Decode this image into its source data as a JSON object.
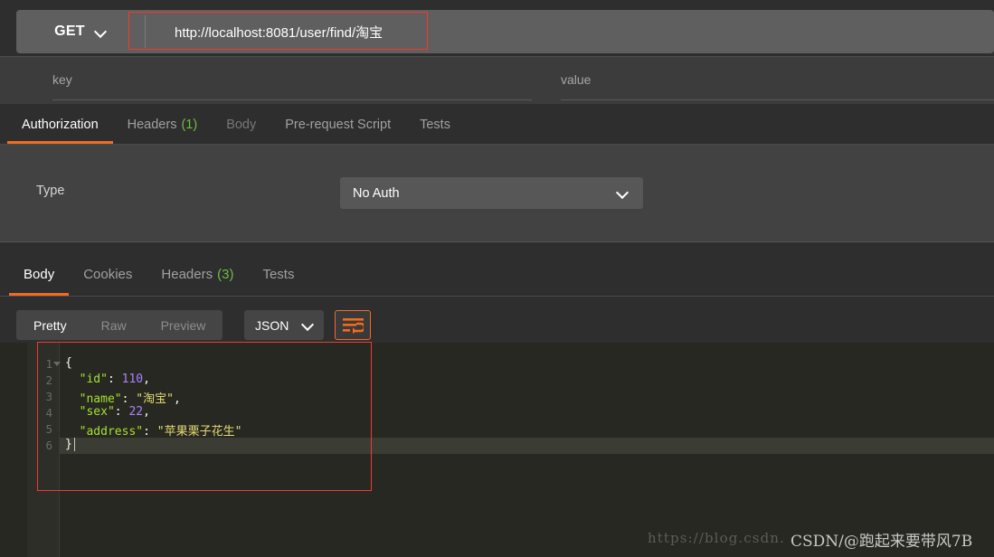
{
  "request": {
    "method": "GET",
    "method_chevron_icon": "chevron-down-icon",
    "url": "http://localhost:8081/user/find/淘宝",
    "params": {
      "key_placeholder": "key",
      "value_placeholder": "value"
    },
    "tabs": [
      {
        "label": "Authorization",
        "count": "",
        "state": "active"
      },
      {
        "label": "Headers",
        "count": "(1)",
        "state": "normal"
      },
      {
        "label": "Body",
        "count": "",
        "state": "dim"
      },
      {
        "label": "Pre-request Script",
        "count": "",
        "state": "normal"
      },
      {
        "label": "Tests",
        "count": "",
        "state": "normal"
      }
    ],
    "auth": {
      "type_label": "Type",
      "type_value": "No Auth",
      "chevron_icon": "chevron-down-icon"
    }
  },
  "response": {
    "tabs": [
      {
        "label": "Body",
        "count": "",
        "state": "active"
      },
      {
        "label": "Cookies",
        "count": "",
        "state": "normal"
      },
      {
        "label": "Headers",
        "count": "(3)",
        "state": "normal"
      },
      {
        "label": "Tests",
        "count": "",
        "state": "normal"
      }
    ],
    "view_modes": [
      {
        "label": "Pretty",
        "state": "active"
      },
      {
        "label": "Raw",
        "state": "normal"
      },
      {
        "label": "Preview",
        "state": "normal"
      }
    ],
    "format": "JSON",
    "format_chevron_icon": "chevron-down-icon",
    "wrap_icon": "wrap-lines-icon",
    "body_lines": [
      {
        "num": "1",
        "fold": true,
        "text": "{"
      },
      {
        "num": "2",
        "fold": false,
        "text": "    \"id\": 110,"
      },
      {
        "num": "3",
        "fold": false,
        "text": "    \"name\": \"淘宝\","
      },
      {
        "num": "4",
        "fold": false,
        "text": "    \"sex\": 22,"
      },
      {
        "num": "5",
        "fold": false,
        "text": "    \"address\": \"苹果栗子花生\""
      },
      {
        "num": "6",
        "fold": false,
        "text": "}"
      }
    ],
    "body_json": {
      "id": 110,
      "name": "淘宝",
      "sex": 22,
      "address": "苹果栗子花生"
    }
  },
  "annotations": {
    "url_box_color": "#f4382f",
    "json_box_color": "#f4382f"
  },
  "watermark": {
    "url": "https://blog.csdn.",
    "brand": "CSDN/@跑起来要带风7B"
  },
  "colors": {
    "accent": "#f26b21",
    "count_green": "#6bbf3f",
    "panel_bg": "#424242",
    "app_bg": "#2e2e2e",
    "editor_bg": "#272822"
  }
}
